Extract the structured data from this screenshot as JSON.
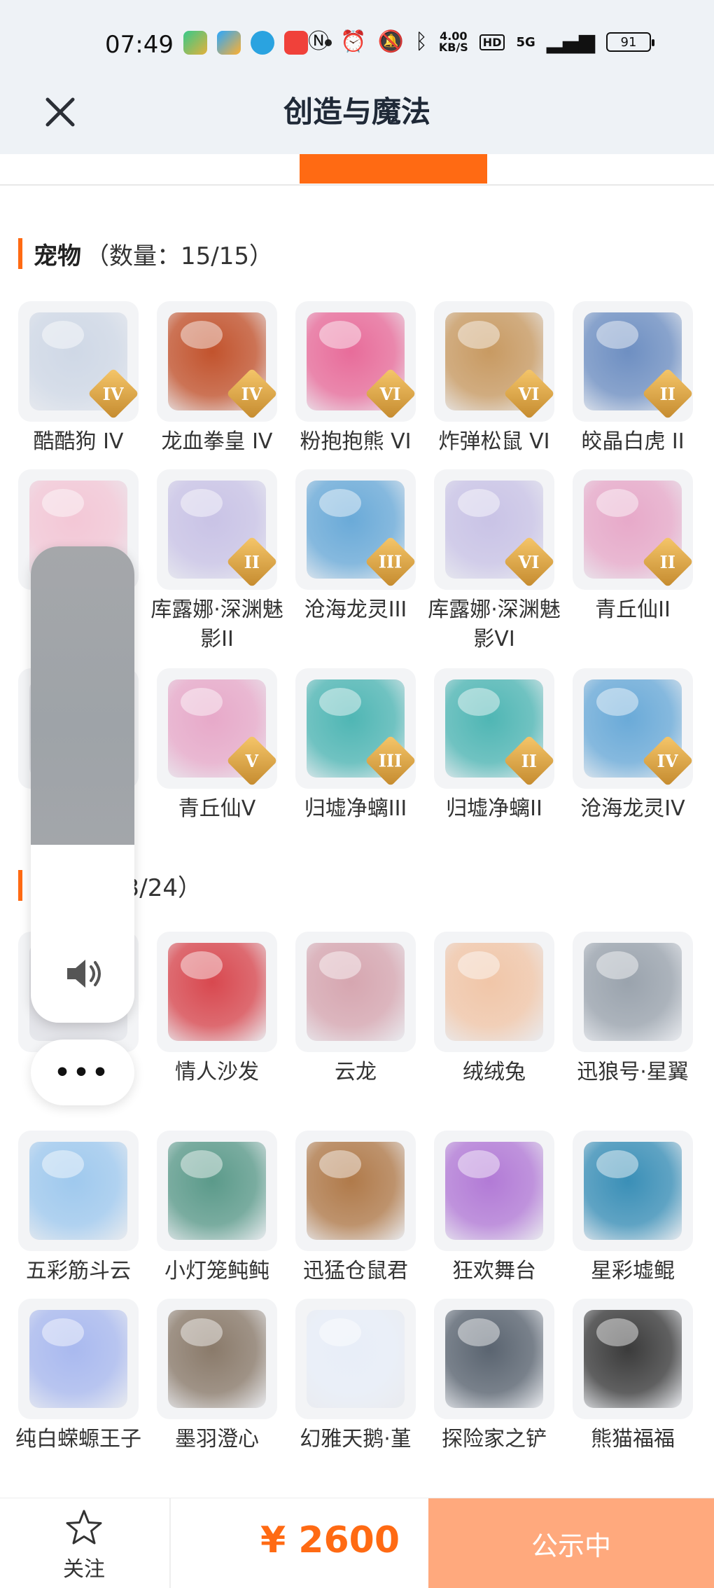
{
  "status_bar": {
    "time": "07:49",
    "net_speed_value": "4.00",
    "net_speed_unit": "KB/S",
    "hd": "HD",
    "signal": "5G",
    "battery": "91"
  },
  "header": {
    "title": "创造与魔法"
  },
  "sections": [
    {
      "name": "宠物",
      "count": "（数量：15/15）",
      "items": [
        {
          "label": "酷酷狗 IV",
          "rank": "IV",
          "color": "#cfd8e6"
        },
        {
          "label": "龙血拳皇 IV",
          "rank": "IV",
          "color": "#c2532d"
        },
        {
          "label": "粉抱抱熊 VI",
          "rank": "VI",
          "color": "#e86c9a"
        },
        {
          "label": "炸弹松鼠 VI",
          "rank": "VI",
          "color": "#c89a62"
        },
        {
          "label": "皎晶白虎 II",
          "rank": "II",
          "color": "#6e8fc2"
        },
        {
          "label": "",
          "rank": "",
          "color": "#f3c7d6"
        },
        {
          "label": "库露娜·深渊魅影II",
          "rank": "II",
          "color": "#c9c3e6"
        },
        {
          "label": "沧海龙灵III",
          "rank": "III",
          "color": "#6aaad8"
        },
        {
          "label": "库露娜·深渊魅影VI",
          "rank": "VI",
          "color": "#c9c3e6"
        },
        {
          "label": "青丘仙II",
          "rank": "II",
          "color": "#e7a9c9"
        },
        {
          "label": "",
          "rank": "",
          "color": "#d9d9df"
        },
        {
          "label": "青丘仙V",
          "rank": "V",
          "color": "#e7a9c9"
        },
        {
          "label": "归墟净螭III",
          "rank": "III",
          "color": "#4fb6b4"
        },
        {
          "label": "归墟净螭II",
          "rank": "II",
          "color": "#4fb6b4"
        },
        {
          "label": "沧海龙灵IV",
          "rank": "IV",
          "color": "#6aaad8"
        }
      ]
    },
    {
      "name": "",
      "count": "数量：23/24）",
      "items": [
        {
          "label": "",
          "color": "#d9d9df"
        },
        {
          "label": "情人沙发",
          "color": "#d8484f"
        },
        {
          "label": "云龙",
          "color": "#d6a6b0"
        },
        {
          "label": "绒绒兔",
          "color": "#f1c6a8"
        },
        {
          "label": "迅狼号·星翼",
          "color": "#9aa3ad"
        },
        {
          "label": "五彩筋斗云",
          "color": "#9fc9ee"
        },
        {
          "label": "小灯笼鲀鲀",
          "color": "#5b9a8a"
        },
        {
          "label": "迅猛仓鼠君",
          "color": "#b07a4a"
        },
        {
          "label": "狂欢舞台",
          "color": "#b27ad6"
        },
        {
          "label": "星彩墟鲲",
          "color": "#3a8fb7"
        },
        {
          "label": "纯白蝾螈王子",
          "color": "#a9b9ef"
        },
        {
          "label": "墨羽澄心",
          "color": "#8a7a6a"
        },
        {
          "label": "幻雅天鹅·堇",
          "color": "#e8eef8"
        },
        {
          "label": "探险家之铲",
          "color": "#5a6470"
        },
        {
          "label": "熊猫福福",
          "color": "#3b3b3b"
        }
      ]
    }
  ],
  "floating": {
    "more": "•••"
  },
  "bottom": {
    "follow_label": "关注",
    "price": "¥ 2600",
    "status_button": "公示中"
  },
  "colors": {
    "accent": "#ff6a13",
    "status_button": "#ffa97d"
  }
}
